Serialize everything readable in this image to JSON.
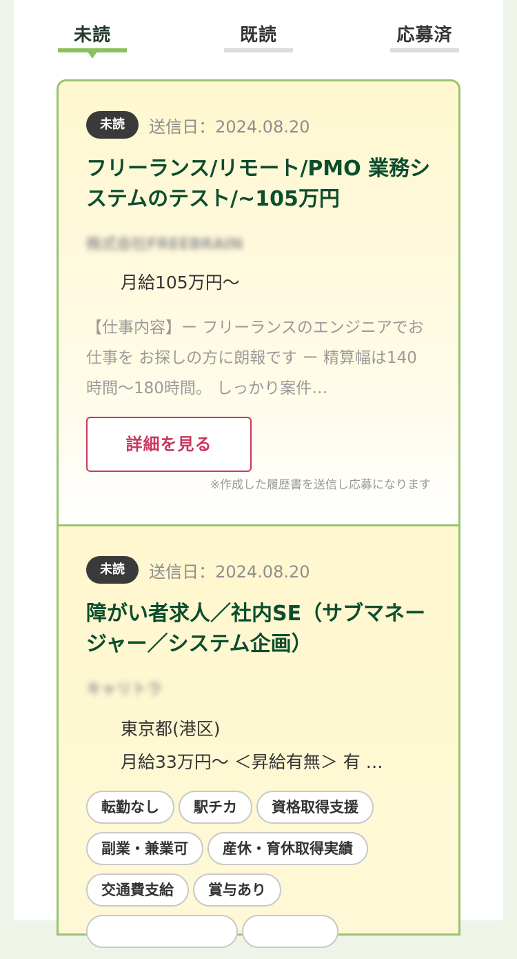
{
  "tabs": [
    {
      "label": "未読",
      "active": true
    },
    {
      "label": "既読",
      "active": false
    },
    {
      "label": "応募済",
      "active": false
    }
  ],
  "jobs": [
    {
      "badge": "未読",
      "sent_date": "送信日：2024.08.20",
      "title": "フリーランス/リモート/PMO 業務システムのテスト/~105万円",
      "company": "株式会社FREEBRAIN",
      "salary": "月給105万円〜",
      "description": "【仕事内容】ー フリーランスのエンジニアでお仕事を お探しの方に朗報です ー 精算幅は140時間〜180時間。 しっかり案件…",
      "detail_button": "詳細を見る",
      "note": "※作成した履歴書を送信し応募になります"
    },
    {
      "badge": "未読",
      "sent_date": "送信日：2024.08.20",
      "title": "障がい者求人／社内SE（サブマネージャー／システム企画）",
      "company": "キャリトラ",
      "location": "東京都(港区)",
      "salary": "月給33万円〜 ＜昇給有無＞ 有 …",
      "tags": [
        "転勤なし",
        "駅チカ",
        "資格取得支援",
        "副業・兼業可",
        "産休・育休取得実績",
        "交通費支給",
        "賞与あり",
        "",
        ""
      ]
    }
  ],
  "colors": {
    "accent_green": "#8cc05f",
    "title_green": "#0c4d2e",
    "button_red": "#c8385f"
  }
}
